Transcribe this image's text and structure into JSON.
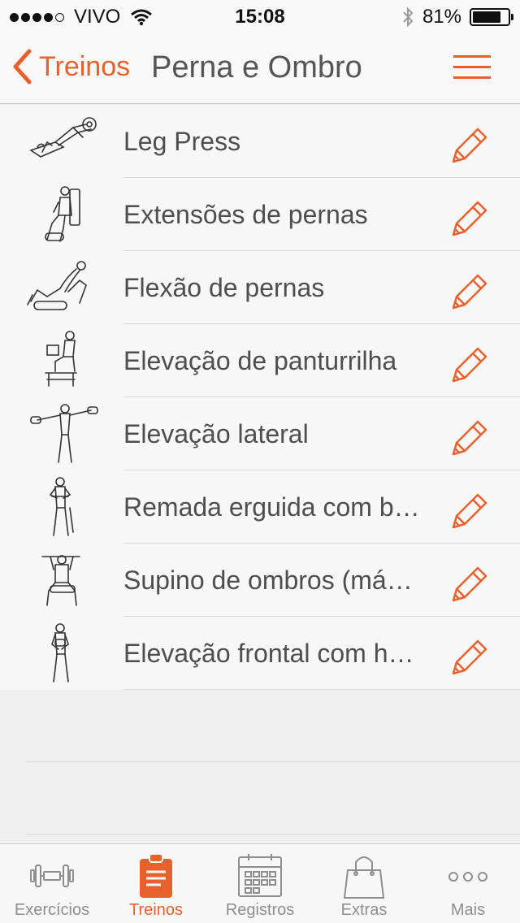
{
  "status_bar": {
    "carrier": "VIVO",
    "time": "15:08",
    "battery": "81%",
    "battery_level": 0.81,
    "signal_bars_filled": 4,
    "signal_bars_total": 5
  },
  "nav": {
    "back_label": "Treinos",
    "title": "Perna e Ombro"
  },
  "colors": {
    "accent": "#e8602c",
    "text": "#4e4e4e",
    "tab_inactive": "#8e8e8e"
  },
  "exercises": [
    {
      "name": "Leg Press",
      "icon": "leg-press-illustration"
    },
    {
      "name": "Extensões de pernas",
      "icon": "leg-extension-illustration"
    },
    {
      "name": "Flexão de pernas",
      "icon": "leg-curl-illustration"
    },
    {
      "name": "Elevação de panturrilha",
      "icon": "calf-raise-illustration"
    },
    {
      "name": "Elevação lateral",
      "icon": "lateral-raise-illustration"
    },
    {
      "name": "Remada erguida com barra",
      "icon": "upright-row-illustration"
    },
    {
      "name": "Supino de ombros (máquina)",
      "icon": "shoulder-press-illustration"
    },
    {
      "name": "Elevação frontal com halteres",
      "icon": "front-raise-illustration"
    }
  ],
  "tabs": [
    {
      "label": "Exercícios",
      "icon": "dumbbell-icon",
      "active": false
    },
    {
      "label": "Treinos",
      "icon": "clipboard-icon",
      "active": true
    },
    {
      "label": "Registros",
      "icon": "calendar-icon",
      "active": false
    },
    {
      "label": "Extras",
      "icon": "shopping-bag-icon",
      "active": false
    },
    {
      "label": "Mais",
      "icon": "more-icon",
      "active": false
    }
  ]
}
